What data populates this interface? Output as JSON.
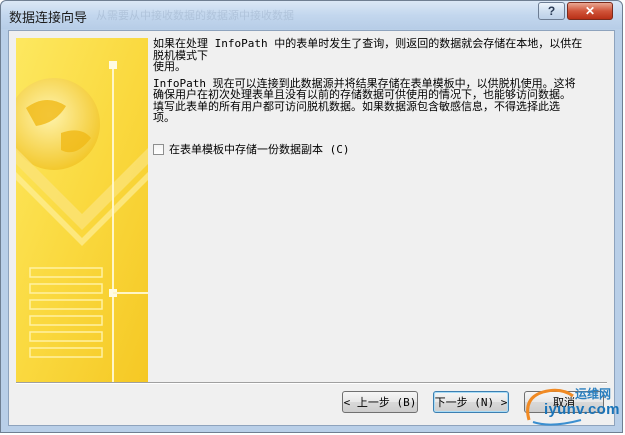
{
  "window": {
    "title": "数据连接向导",
    "ghost_title": "从需要从中接收数据的数据源中接收数据",
    "help_label": "?",
    "close_label": "✕"
  },
  "content": {
    "paragraph1": "如果在处理 InfoPath 中的表单时发生了查询，则返回的数据就会存储在本地，以供在\n脱机模式下\n使用。",
    "paragraph2": "InfoPath 现在可以连接到此数据源并将结果存储在表单模板中，以供脱机使用。这将\n确保用户在初次处理表单且没有以前的存储数据可供使用的情况下，也能够访问数据。\n填写此表单的所有用户都可访问脱机数据。如果数据源包含敏感信息，不得选择此选\n项。",
    "checkbox_label": "在表单模板中存储一份数据副本 (C)",
    "checkbox_checked": false
  },
  "buttons": {
    "back": "< 上一步 (B)",
    "next": "下一步 (N) >",
    "cancel": "取消"
  },
  "watermark": {
    "brand": "iyunv.com",
    "cn": "运维网"
  }
}
